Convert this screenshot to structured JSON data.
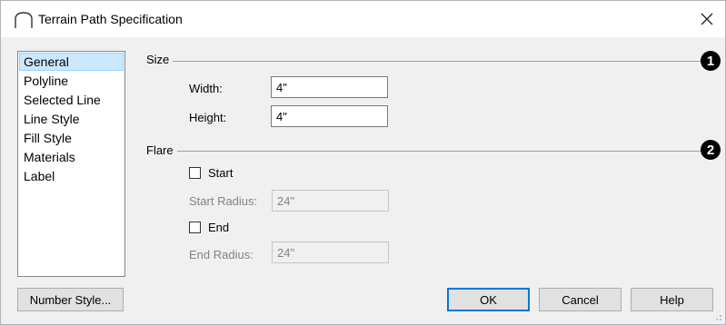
{
  "window": {
    "title": "Terrain Path Specification"
  },
  "nav": {
    "items": [
      {
        "label": "General",
        "selected": true
      },
      {
        "label": "Polyline",
        "selected": false
      },
      {
        "label": "Selected Line",
        "selected": false
      },
      {
        "label": "Line Style",
        "selected": false
      },
      {
        "label": "Fill Style",
        "selected": false
      },
      {
        "label": "Materials",
        "selected": false
      },
      {
        "label": "Label",
        "selected": false
      }
    ]
  },
  "size": {
    "label": "Size",
    "callout": "1",
    "width_label": "Width:",
    "width_value": "4\"",
    "height_label": "Height:",
    "height_value": "4\""
  },
  "flare": {
    "label": "Flare",
    "callout": "2",
    "start_label": "Start",
    "start_checked": false,
    "start_radius_label": "Start Radius:",
    "start_radius_value": "24\"",
    "end_label": "End",
    "end_checked": false,
    "end_radius_label": "End Radius:",
    "end_radius_value": "24\""
  },
  "buttons": {
    "number_style": "Number Style...",
    "ok": "OK",
    "cancel": "Cancel",
    "help": "Help"
  },
  "colors": {
    "selection": "#cce8ff",
    "default_button_border": "#0078d7",
    "dialog_bg": "#f0f0f0"
  }
}
